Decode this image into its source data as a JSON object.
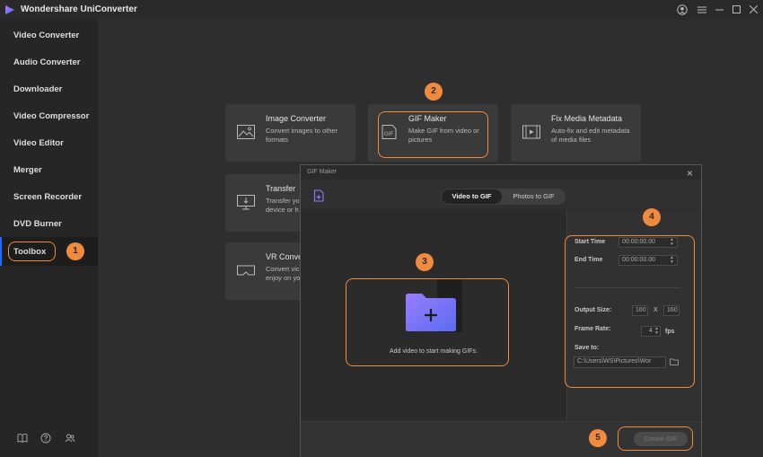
{
  "app": {
    "title": "Wondershare UniConverter"
  },
  "window_controls": [
    "account-icon",
    "menu-icon",
    "minimize-icon",
    "maximize-icon",
    "close-icon"
  ],
  "sidebar": {
    "items": [
      {
        "label": "Video Converter"
      },
      {
        "label": "Audio Converter"
      },
      {
        "label": "Downloader"
      },
      {
        "label": "Video Compressor"
      },
      {
        "label": "Video Editor"
      },
      {
        "label": "Merger"
      },
      {
        "label": "Screen Recorder"
      },
      {
        "label": "DVD Burner"
      },
      {
        "label": "Toolbox",
        "selected": true
      }
    ],
    "bottom_icons": [
      "book-icon",
      "help-icon",
      "users-icon"
    ]
  },
  "tools": [
    {
      "title": "Image Converter",
      "desc": "Convert images to other formats"
    },
    {
      "title": "GIF Maker",
      "desc": "Make GIF from video or pictures"
    },
    {
      "title": "Fix Media Metadata",
      "desc": "Auto-fix and edit metadata of media files"
    },
    {
      "title": "Transfer",
      "desc": "Transfer yo device or h"
    },
    {
      "title": "VR Conver",
      "desc": "Convert vic enjoy on yo"
    }
  ],
  "dialog": {
    "title": "GIF Maker",
    "tabs": [
      {
        "label": "Video to GIF",
        "active": true
      },
      {
        "label": "Photos to GIF",
        "active": false
      }
    ],
    "drop_hint": "Add video to start making GIFs.",
    "settings": {
      "start_time_label": "Start Time",
      "start_time": "00:00:00.00",
      "end_time_label": "End Time",
      "end_time": "00:00:00.00",
      "output_size_label": "Output Size:",
      "width": "160",
      "x_sep": "X",
      "height": "160",
      "frame_rate_label": "Frame Rate:",
      "frame_rate": "4",
      "fps_label": "fps",
      "save_to_label": "Save to:",
      "save_path": "C:\\Users\\WS\\Pictures\\Wor"
    },
    "create_button": "Create GIF"
  },
  "badges": [
    "1",
    "2",
    "3",
    "4",
    "5"
  ],
  "colors": {
    "accent": "#f08a3c",
    "folder": "#7b6cf6"
  }
}
